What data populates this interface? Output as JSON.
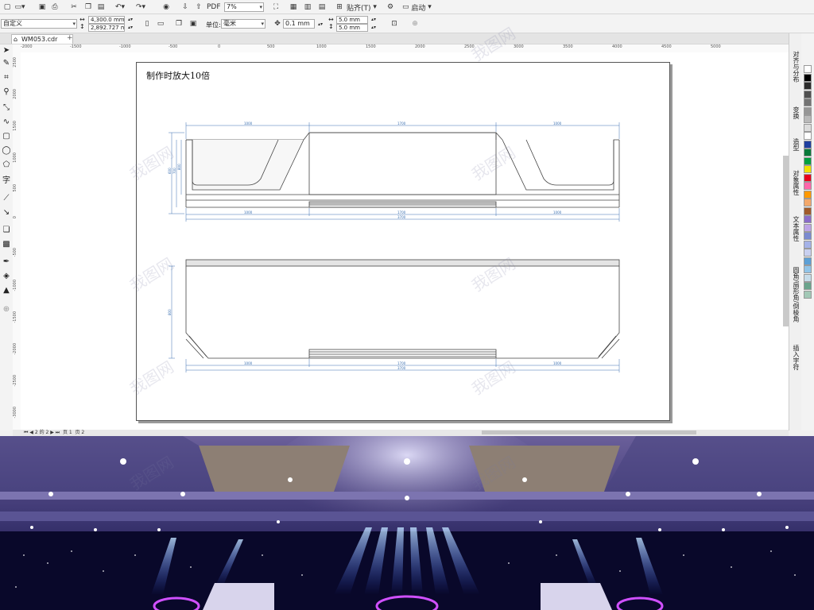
{
  "toolbar1": {
    "zoom": "7%",
    "snap_label": "贴齐(T)",
    "launch_label": "启动"
  },
  "toolbar2": {
    "preset": "自定义",
    "width": "4,300.0 mm",
    "height": "2,892.727 mr",
    "units_label": "单位:",
    "units_value": "毫米",
    "nudge": "0.1 mm",
    "dup_x": "5.0 mm",
    "dup_y": "5.0 mm"
  },
  "document": {
    "tab_name": "WM053.cdr",
    "page_title": "制作时放大10倍"
  },
  "ruler_top": [
    "-2000",
    "-1500",
    "-1000",
    "-500",
    "0",
    "500",
    "1000",
    "1500",
    "2000",
    "2500",
    "3000",
    "3500",
    "4000",
    "4500",
    "5000"
  ],
  "ruler_left": [
    "2500",
    "2000",
    "1500",
    "1000",
    "500",
    "0",
    "-500",
    "-1000",
    "-1500",
    "-2000",
    "-2500",
    "-3000"
  ],
  "dimensions": {
    "front_top": [
      "1000",
      "1700",
      "1000"
    ],
    "front_bottom": [
      "1000",
      "1700",
      "1000"
    ],
    "front_total": "3700",
    "front_side": [
      "600",
      "700",
      "800"
    ],
    "plan_bottom": [
      "1000",
      "1700",
      "1000"
    ],
    "plan_total": "3700",
    "plan_side": "800"
  },
  "right_dock": {
    "tabs": [
      "对齐与分布",
      "变换",
      "造型",
      "对象属性",
      "文本属性",
      "圆角/扇形角/倒棱角",
      "插入字符"
    ]
  },
  "palette": {
    "colors": [
      "#ffffff",
      "#000000",
      "#2b2b2b",
      "#505050",
      "#737373",
      "#969696",
      "#b9b9b9",
      "#dcdcdc",
      "#ffffff",
      "#1f3fa0",
      "#0a7a3a",
      "#00a040",
      "#f0e000",
      "#e8001c",
      "#ff66aa",
      "#ff9900",
      "#f3a86b",
      "#a05a2a",
      "#8a6cc9",
      "#bda4e6",
      "#7a8ad0",
      "#a4b2e8",
      "#c9d0f0",
      "#5ca0d6",
      "#91c4e8",
      "#c6dcea",
      "#6aa48c",
      "#a2c8b6"
    ]
  },
  "status": {
    "page_count": "2 的 2",
    "page_tab1": "页 1",
    "page_tab2": "页 2"
  },
  "watermark": "我图网"
}
